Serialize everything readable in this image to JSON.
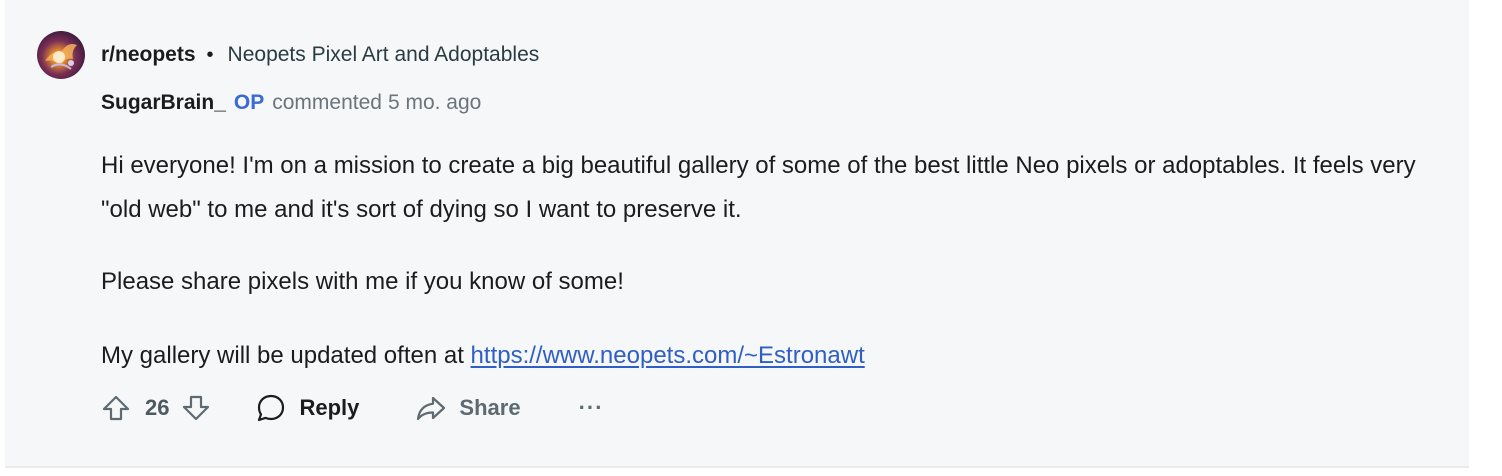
{
  "post": {
    "subreddit": "r/neopets",
    "separator": "•",
    "title": "Neopets Pixel Art and Adoptables"
  },
  "comment": {
    "author": "SugarBrain_",
    "op_badge": "OP",
    "action": "commented",
    "time": "5 mo. ago",
    "body": {
      "p1": "Hi everyone! I'm on a mission to create a big beautiful gallery of some of the best little Neo pixels or adoptables. It feels very \"old web\" to me and it's sort of dying so I want to preserve it.",
      "p2": "Please share pixels with me if you know of some!",
      "p3_prefix": "My gallery will be updated often at ",
      "p3_link": "https://www.neopets.com/~Estronawt"
    }
  },
  "actions": {
    "score": "26",
    "reply_label": "Reply",
    "share_label": "Share",
    "more_label": "···"
  },
  "icons": {
    "upvote": "arrow-up-outline-icon",
    "downvote": "arrow-down-outline-icon",
    "reply": "speech-bubble-icon",
    "share": "share-arrow-icon",
    "more": "ellipsis-icon"
  },
  "colors": {
    "card_bg": "#f6f7f8",
    "op": "#3a6ad5",
    "link": "#2f5fc4",
    "muted": "#6a757b"
  }
}
